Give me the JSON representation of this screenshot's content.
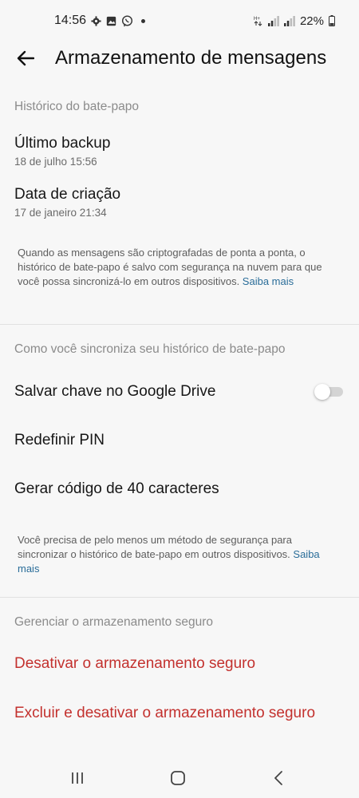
{
  "status_bar": {
    "time": "14:56",
    "battery": "22%",
    "icons": [
      "gear-icon",
      "gallery-icon",
      "viber-icon",
      "notification-dot",
      "data-arrows-icon",
      "signal-icon",
      "signal-r-icon",
      "battery-icon"
    ]
  },
  "header": {
    "back_icon": "arrow-left-icon",
    "title": "Armazenamento de mensagens"
  },
  "chat_history": {
    "section_label": "Histórico do bate-papo",
    "last_backup": {
      "label": "Último backup",
      "value": "18 de julho 15:56"
    },
    "created": {
      "label": "Data de criação",
      "value": "17 de janeiro 21:34"
    },
    "note": "Quando as mensagens são criptografadas de ponta a ponta, o histórico de bate-papo é salvo com segurança na nuvem para que você possa sincronizá-lo em outros dispositivos. ",
    "note_link": "Saiba mais"
  },
  "sync": {
    "section_label": "Como você sincroniza seu histórico de bate-papo",
    "google_drive": {
      "label": "Salvar chave no Google Drive",
      "enabled": false
    },
    "reset_pin": "Redefinir PIN",
    "generate_code": "Gerar código de 40 caracteres",
    "note": "Você precisa de pelo menos um método de segurança para sincronizar o histórico de bate-papo em outros dispositivos. ",
    "note_link": "Saiba mais"
  },
  "secure_storage": {
    "section_label": "Gerenciar o armazenamento seguro",
    "disable": "Desativar o armazenamento seguro",
    "delete_disable": "Excluir e desativar o armazenamento seguro"
  },
  "colors": {
    "background": "#f7f7f7",
    "danger": "#c3312e",
    "link": "#2a6d99",
    "section_header": "#8b8b8b"
  },
  "navigation_bar": {
    "icons": [
      "recent-apps-icon",
      "home-icon",
      "back-nav-icon"
    ]
  }
}
